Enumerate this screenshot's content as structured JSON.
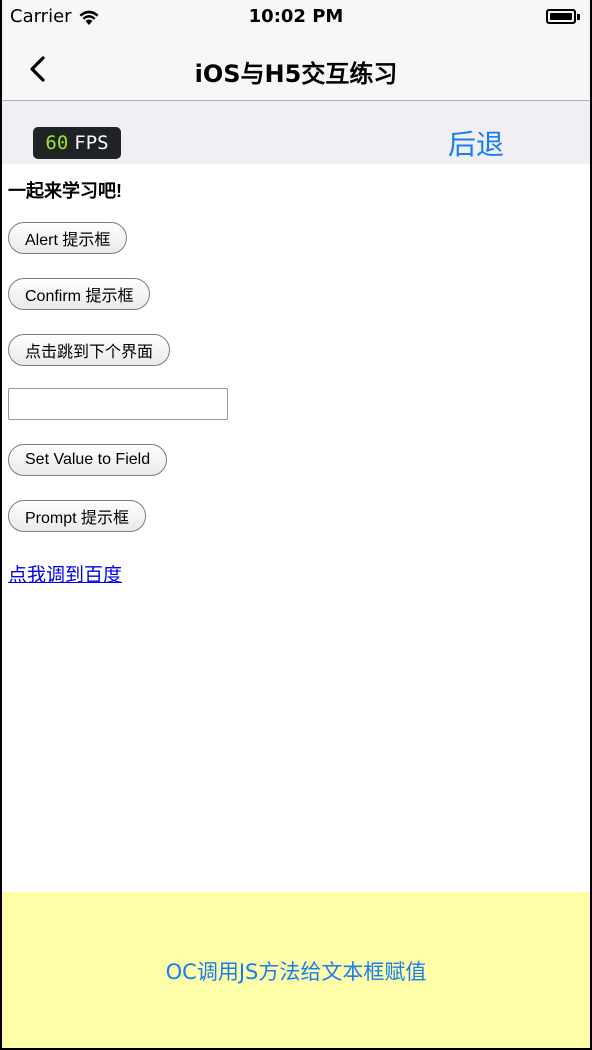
{
  "status_bar": {
    "carrier": "Carrier",
    "time": "10:02 PM"
  },
  "nav": {
    "title": "iOS与H5交互练习",
    "back_icon": "chevron-left-icon"
  },
  "toolbar": {
    "fps_value": "60",
    "fps_label": "FPS",
    "back_label": "后退"
  },
  "web": {
    "heading": "一起来学习吧!",
    "buttons": {
      "alert": "Alert 提示框",
      "confirm": "Confirm 提示框",
      "jump": "点击跳到下个界面",
      "set_value": "Set Value to Field",
      "prompt": "Prompt 提示框"
    },
    "text_field_value": "",
    "link": "点我调到百度"
  },
  "bottom": {
    "label": "OC调用JS方法给文本框赋值"
  },
  "colors": {
    "accent": "#1a7cf2",
    "bottom_bg": "#fffea8",
    "fps_green": "#9ae620",
    "link": "#0000ee"
  }
}
